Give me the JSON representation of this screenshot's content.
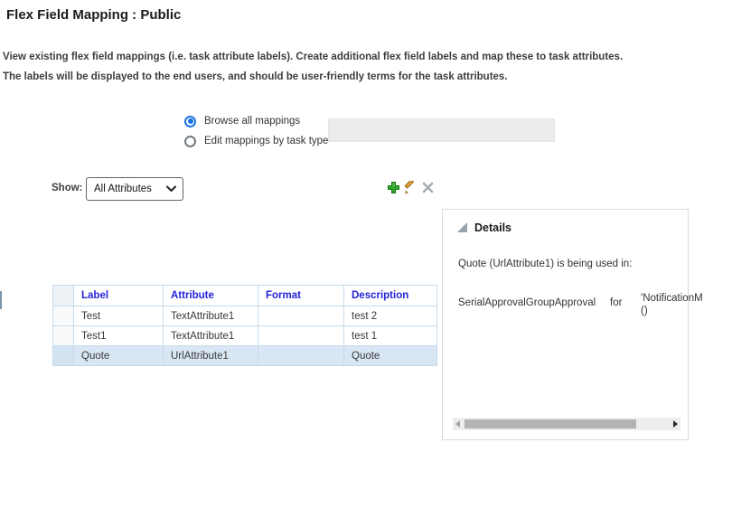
{
  "page": {
    "title": "Flex Field Mapping : Public"
  },
  "intro": {
    "line1": "View existing flex field mappings (i.e. task attribute labels). Create additional flex field labels and map these to task attributes.",
    "line2": "The labels will be displayed to the end users, and should be user-friendly terms for the task attributes."
  },
  "mapping_mode": {
    "options": [
      {
        "label": "Browse all mappings",
        "selected": true
      },
      {
        "label": "Edit mappings by task type",
        "selected": false
      }
    ],
    "task_type_field_value": ""
  },
  "show_filter": {
    "label": "Show:",
    "selected_option": "All Attributes"
  },
  "toolbar": {
    "icons": [
      {
        "name": "add-icon",
        "enabled": true
      },
      {
        "name": "edit-icon",
        "enabled": true
      },
      {
        "name": "delete-icon",
        "enabled": false
      }
    ]
  },
  "table": {
    "columns": {
      "selector": "",
      "label": "Label",
      "attribute": "Attribute",
      "format": "Format",
      "description": "Description"
    },
    "rows": [
      {
        "label": "Test",
        "attribute": "TextAttribute1",
        "format": "",
        "description": "test 2",
        "selected": false
      },
      {
        "label": "Test1",
        "attribute": "TextAttribute1",
        "format": "",
        "description": "test 1",
        "selected": false
      },
      {
        "label": "Quote",
        "attribute": "UrlAttribute1",
        "format": "",
        "description": "Quote",
        "selected": true
      }
    ]
  },
  "details": {
    "title": "Details",
    "usage_text": "Quote (UrlAttribute1) is being used in:",
    "usage_row": {
      "task": "SerialApprovalGroupApproval",
      "connector": "for",
      "target_line1": "'NotificationM",
      "target_line2": "()"
    }
  },
  "icons": {
    "disclosure": "disclosure-triangle-icon",
    "chevron": "chevron-down-icon",
    "scroll_left": "scrollbar-left-arrow-icon",
    "scroll_right": "scrollbar-right-arrow-icon"
  },
  "colors": {
    "accent_blue": "#1a73e8",
    "table_header_text": "#2323d9",
    "table_border": "#c6dbeb",
    "selected_row_bg": "#d9e7f4",
    "add_green": "#2fa32a",
    "pencil_gold": "#dfa232",
    "disabled_gray": "#a6adb3",
    "disabled_field_bg": "#ebeced"
  }
}
